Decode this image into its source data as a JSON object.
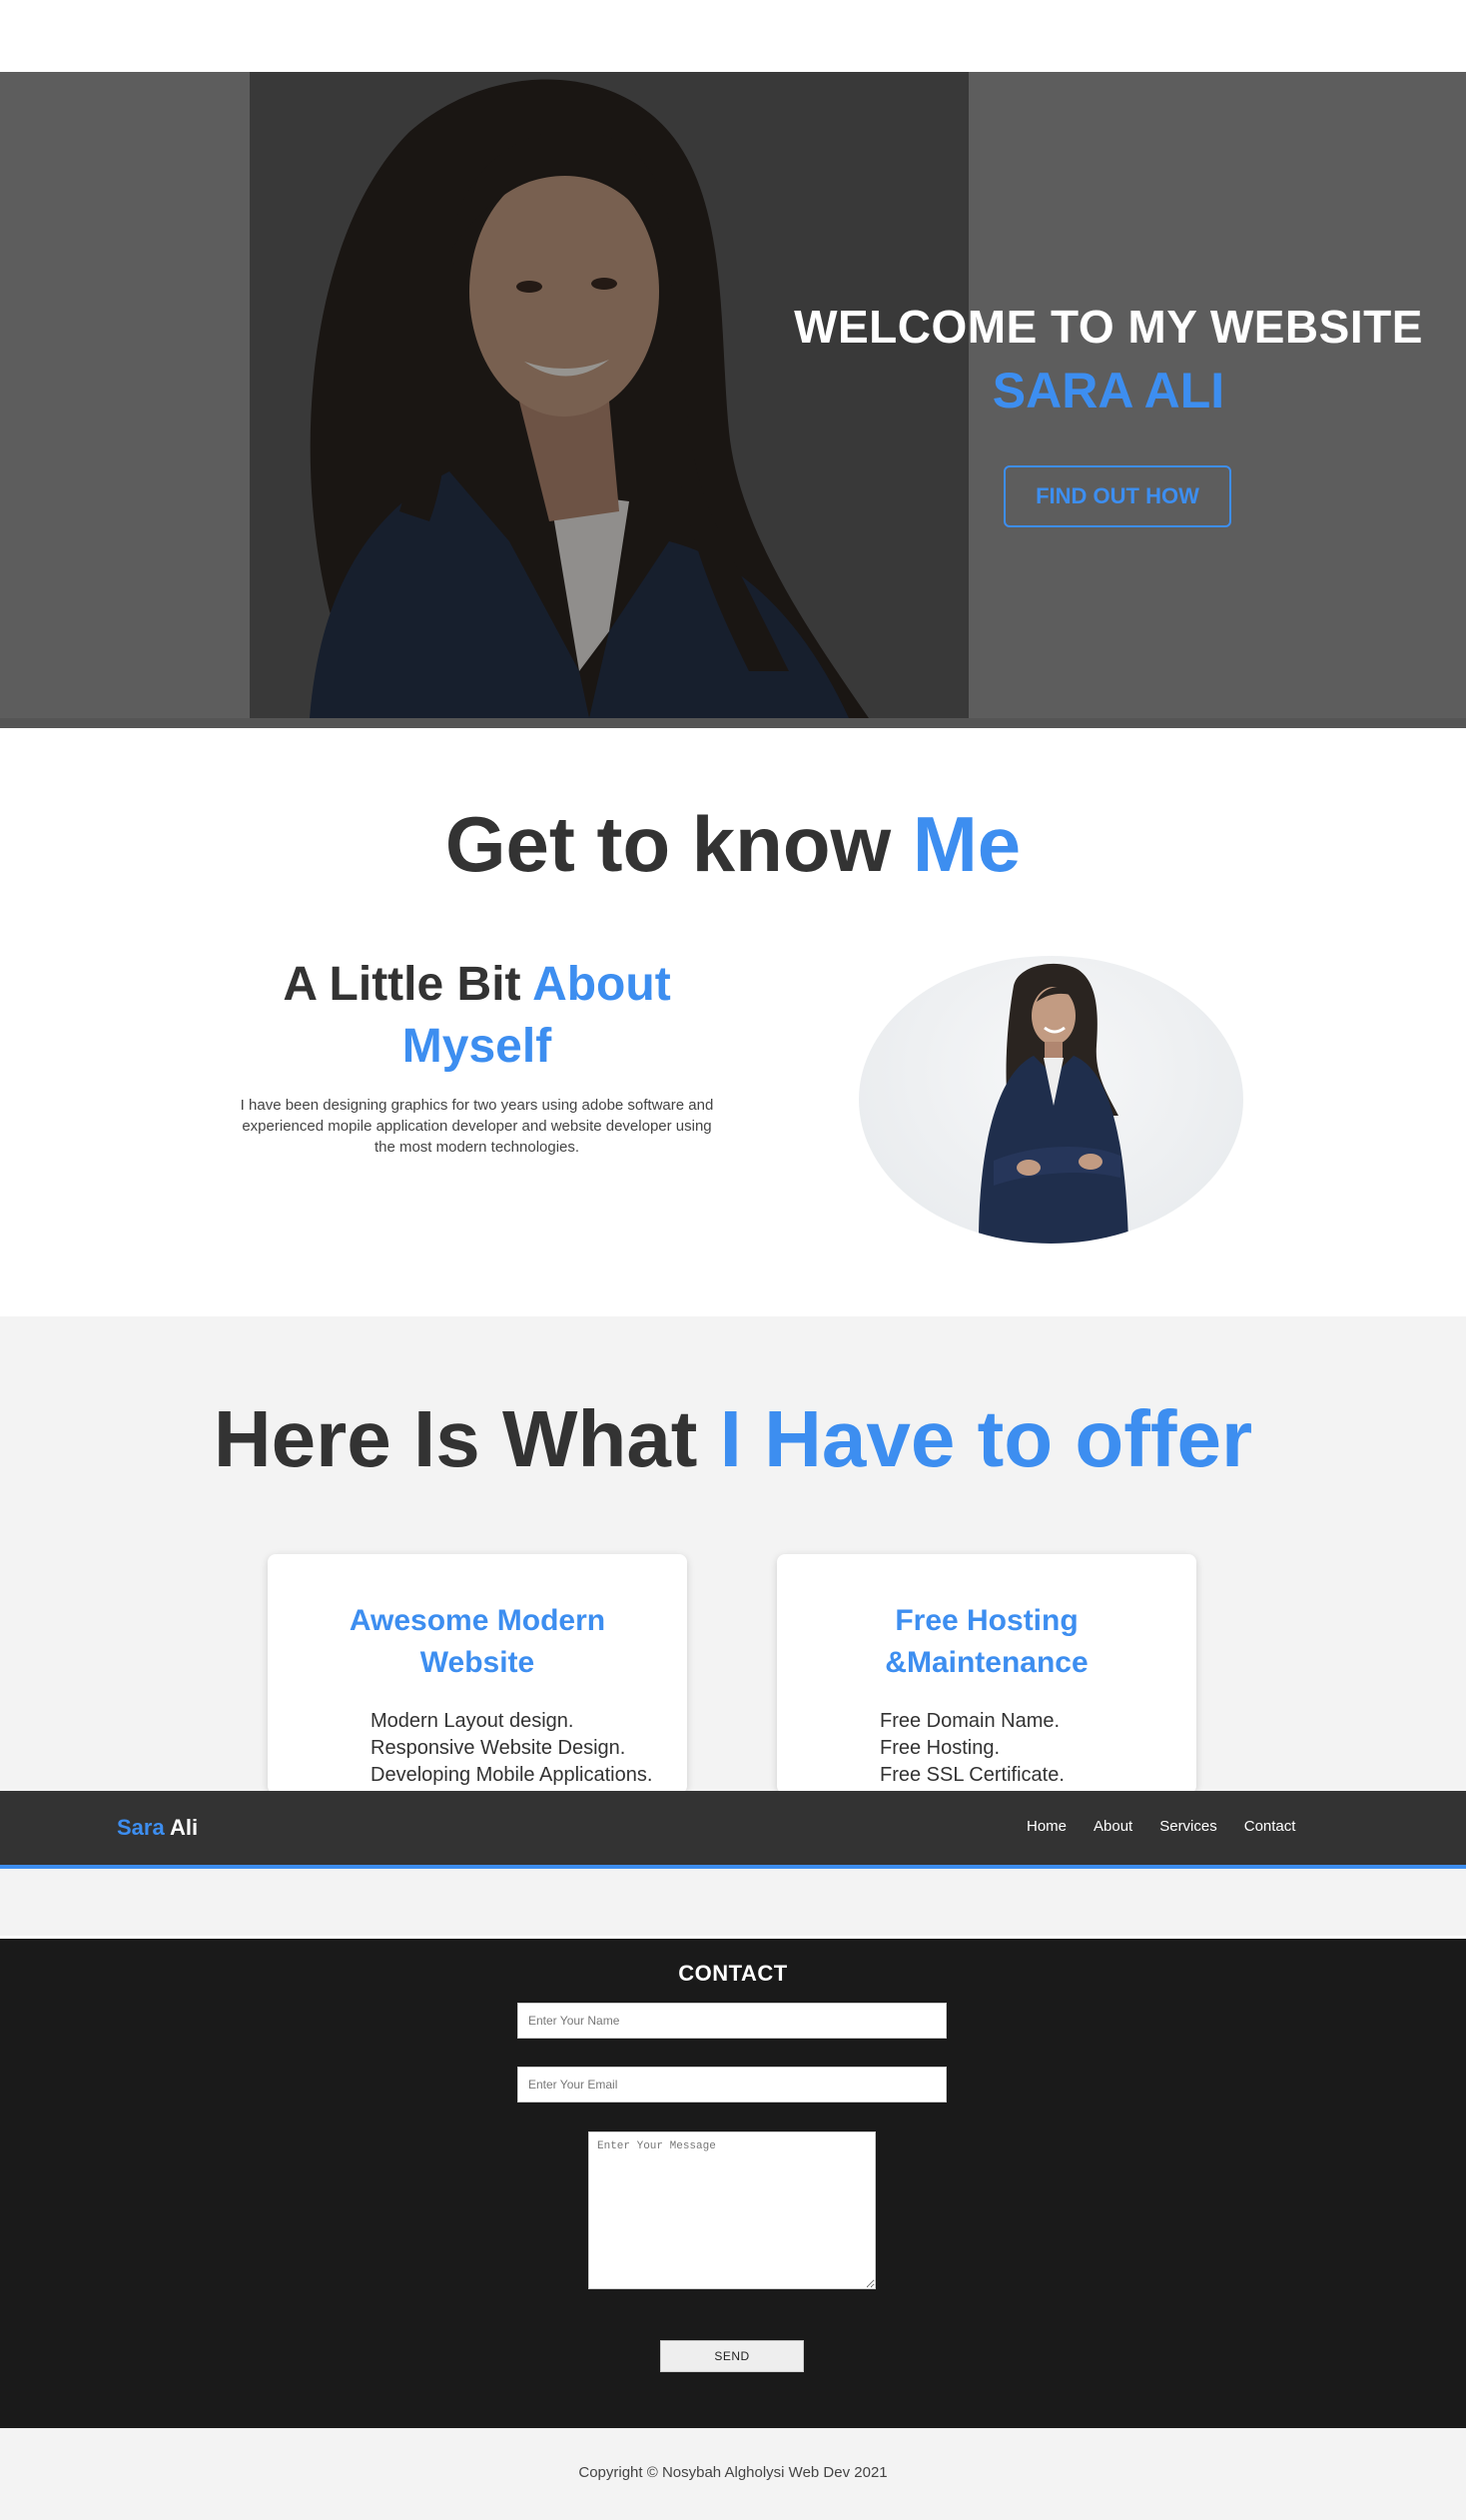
{
  "hero": {
    "welcome": "WELCOME TO MY WEBSITE",
    "name": "SARA ALI",
    "button": "FIND OUT HOW"
  },
  "about": {
    "title_main": "Get to know ",
    "title_accent": "Me",
    "sub_main": "A Little Bit ",
    "sub_accent": "About Myself",
    "text": "I have been designing graphics for two years using adobe software and experienced mopile application developer and website developer using the most modern technologies."
  },
  "services": {
    "title_main": "Here Is What ",
    "title_accent": "I Have to offer",
    "cards": [
      {
        "title": "Awesome Modern Website",
        "items": [
          "Modern Layout design.",
          "Responsive Website Design.",
          "Developing Mobile Applications."
        ]
      },
      {
        "title": "Free Hosting &Maintenance",
        "items": [
          "Free Domain Name.",
          "Free Hosting.",
          "Free SSL Certificate."
        ]
      }
    ]
  },
  "navbar": {
    "logo_first": "Sara",
    "logo_last": " Ali",
    "links": [
      "Home",
      "About",
      "Services",
      "Contact"
    ]
  },
  "contact": {
    "title": "CONTACT",
    "name_placeholder": "Enter Your Name",
    "email_placeholder": "Enter Your Email",
    "message_placeholder": "Enter Your Message",
    "send": "SEND"
  },
  "footer": {
    "copyright": "Copyright © Nosybah Algholysi Web Dev 2021"
  },
  "colors": {
    "accent": "#3d8ef0",
    "dark": "#333333",
    "contact_bg": "#1a1a1a"
  }
}
